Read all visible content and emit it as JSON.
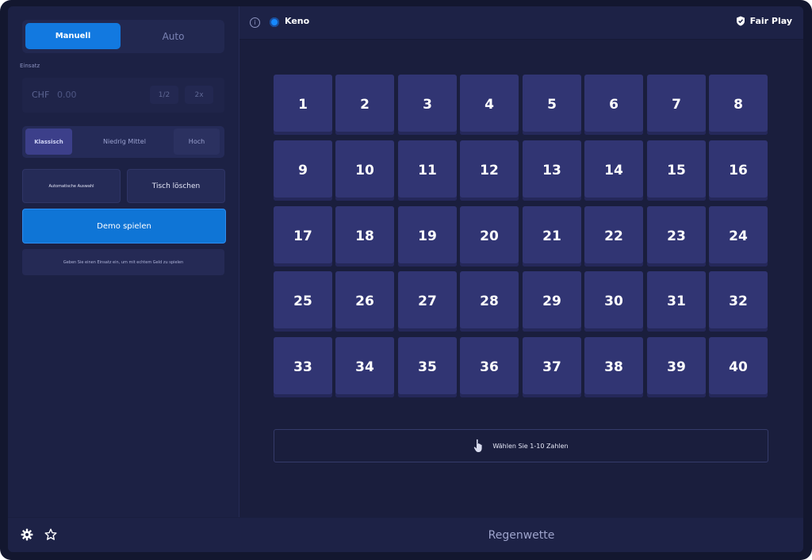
{
  "mode_tabs": {
    "manual": "Manuell",
    "auto": "Auto"
  },
  "stake": {
    "label": "Einsatz",
    "currency": "CHF",
    "value": "0.00",
    "half": "1/2",
    "double": "2x"
  },
  "risk": {
    "klassisch": "Klassisch",
    "niedrig_mittel": "Niedrig Mittel",
    "hoch": "Hoch",
    "selected": "Klassisch"
  },
  "buttons": {
    "auto_select": "Automatische Auswahl",
    "clear_table": "Tisch löschen",
    "play_demo": "Demo spielen"
  },
  "info_text": "Geben Sie einen Einsatz ein, um mit echtem Geld zu spielen",
  "header": {
    "game_title": "Keno",
    "fair_play": "Fair Play"
  },
  "numbers": [
    "1",
    "2",
    "3",
    "4",
    "5",
    "6",
    "7",
    "8",
    "9",
    "10",
    "11",
    "12",
    "13",
    "14",
    "15",
    "16",
    "17",
    "18",
    "19",
    "20",
    "21",
    "22",
    "23",
    "24",
    "25",
    "26",
    "27",
    "28",
    "29",
    "30",
    "31",
    "32",
    "33",
    "34",
    "35",
    "36",
    "37",
    "38",
    "39",
    "40"
  ],
  "prompt": "Wählen Sie 1-10 Zahlen",
  "bottom": {
    "title": "Regenwette"
  },
  "icons": {
    "info": "info-icon",
    "keno": "keno-icon",
    "fair_play": "shield-check-icon",
    "settings": "gear-icon",
    "favorite": "star-icon",
    "prompt": "hand-pointer-icon"
  },
  "colors": {
    "accent": "#1279e0",
    "tile": "#313573",
    "background": "#1a1e3d"
  }
}
